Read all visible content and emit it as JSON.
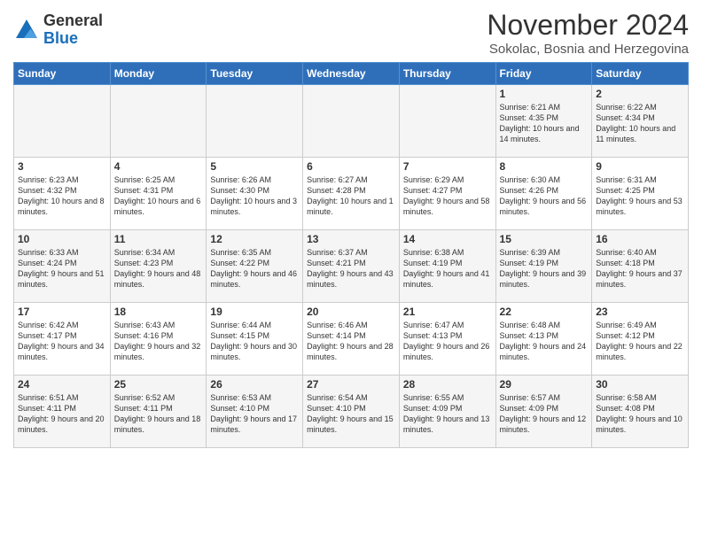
{
  "header": {
    "logo_line1": "General",
    "logo_line2": "Blue",
    "month": "November 2024",
    "location": "Sokolac, Bosnia and Herzegovina"
  },
  "weekdays": [
    "Sunday",
    "Monday",
    "Tuesday",
    "Wednesday",
    "Thursday",
    "Friday",
    "Saturday"
  ],
  "weeks": [
    [
      {
        "day": "",
        "info": ""
      },
      {
        "day": "",
        "info": ""
      },
      {
        "day": "",
        "info": ""
      },
      {
        "day": "",
        "info": ""
      },
      {
        "day": "",
        "info": ""
      },
      {
        "day": "1",
        "info": "Sunrise: 6:21 AM\nSunset: 4:35 PM\nDaylight: 10 hours and 14 minutes."
      },
      {
        "day": "2",
        "info": "Sunrise: 6:22 AM\nSunset: 4:34 PM\nDaylight: 10 hours and 11 minutes."
      }
    ],
    [
      {
        "day": "3",
        "info": "Sunrise: 6:23 AM\nSunset: 4:32 PM\nDaylight: 10 hours and 8 minutes."
      },
      {
        "day": "4",
        "info": "Sunrise: 6:25 AM\nSunset: 4:31 PM\nDaylight: 10 hours and 6 minutes."
      },
      {
        "day": "5",
        "info": "Sunrise: 6:26 AM\nSunset: 4:30 PM\nDaylight: 10 hours and 3 minutes."
      },
      {
        "day": "6",
        "info": "Sunrise: 6:27 AM\nSunset: 4:28 PM\nDaylight: 10 hours and 1 minute."
      },
      {
        "day": "7",
        "info": "Sunrise: 6:29 AM\nSunset: 4:27 PM\nDaylight: 9 hours and 58 minutes."
      },
      {
        "day": "8",
        "info": "Sunrise: 6:30 AM\nSunset: 4:26 PM\nDaylight: 9 hours and 56 minutes."
      },
      {
        "day": "9",
        "info": "Sunrise: 6:31 AM\nSunset: 4:25 PM\nDaylight: 9 hours and 53 minutes."
      }
    ],
    [
      {
        "day": "10",
        "info": "Sunrise: 6:33 AM\nSunset: 4:24 PM\nDaylight: 9 hours and 51 minutes."
      },
      {
        "day": "11",
        "info": "Sunrise: 6:34 AM\nSunset: 4:23 PM\nDaylight: 9 hours and 48 minutes."
      },
      {
        "day": "12",
        "info": "Sunrise: 6:35 AM\nSunset: 4:22 PM\nDaylight: 9 hours and 46 minutes."
      },
      {
        "day": "13",
        "info": "Sunrise: 6:37 AM\nSunset: 4:21 PM\nDaylight: 9 hours and 43 minutes."
      },
      {
        "day": "14",
        "info": "Sunrise: 6:38 AM\nSunset: 4:19 PM\nDaylight: 9 hours and 41 minutes."
      },
      {
        "day": "15",
        "info": "Sunrise: 6:39 AM\nSunset: 4:19 PM\nDaylight: 9 hours and 39 minutes."
      },
      {
        "day": "16",
        "info": "Sunrise: 6:40 AM\nSunset: 4:18 PM\nDaylight: 9 hours and 37 minutes."
      }
    ],
    [
      {
        "day": "17",
        "info": "Sunrise: 6:42 AM\nSunset: 4:17 PM\nDaylight: 9 hours and 34 minutes."
      },
      {
        "day": "18",
        "info": "Sunrise: 6:43 AM\nSunset: 4:16 PM\nDaylight: 9 hours and 32 minutes."
      },
      {
        "day": "19",
        "info": "Sunrise: 6:44 AM\nSunset: 4:15 PM\nDaylight: 9 hours and 30 minutes."
      },
      {
        "day": "20",
        "info": "Sunrise: 6:46 AM\nSunset: 4:14 PM\nDaylight: 9 hours and 28 minutes."
      },
      {
        "day": "21",
        "info": "Sunrise: 6:47 AM\nSunset: 4:13 PM\nDaylight: 9 hours and 26 minutes."
      },
      {
        "day": "22",
        "info": "Sunrise: 6:48 AM\nSunset: 4:13 PM\nDaylight: 9 hours and 24 minutes."
      },
      {
        "day": "23",
        "info": "Sunrise: 6:49 AM\nSunset: 4:12 PM\nDaylight: 9 hours and 22 minutes."
      }
    ],
    [
      {
        "day": "24",
        "info": "Sunrise: 6:51 AM\nSunset: 4:11 PM\nDaylight: 9 hours and 20 minutes."
      },
      {
        "day": "25",
        "info": "Sunrise: 6:52 AM\nSunset: 4:11 PM\nDaylight: 9 hours and 18 minutes."
      },
      {
        "day": "26",
        "info": "Sunrise: 6:53 AM\nSunset: 4:10 PM\nDaylight: 9 hours and 17 minutes."
      },
      {
        "day": "27",
        "info": "Sunrise: 6:54 AM\nSunset: 4:10 PM\nDaylight: 9 hours and 15 minutes."
      },
      {
        "day": "28",
        "info": "Sunrise: 6:55 AM\nSunset: 4:09 PM\nDaylight: 9 hours and 13 minutes."
      },
      {
        "day": "29",
        "info": "Sunrise: 6:57 AM\nSunset: 4:09 PM\nDaylight: 9 hours and 12 minutes."
      },
      {
        "day": "30",
        "info": "Sunrise: 6:58 AM\nSunset: 4:08 PM\nDaylight: 9 hours and 10 minutes."
      }
    ]
  ]
}
